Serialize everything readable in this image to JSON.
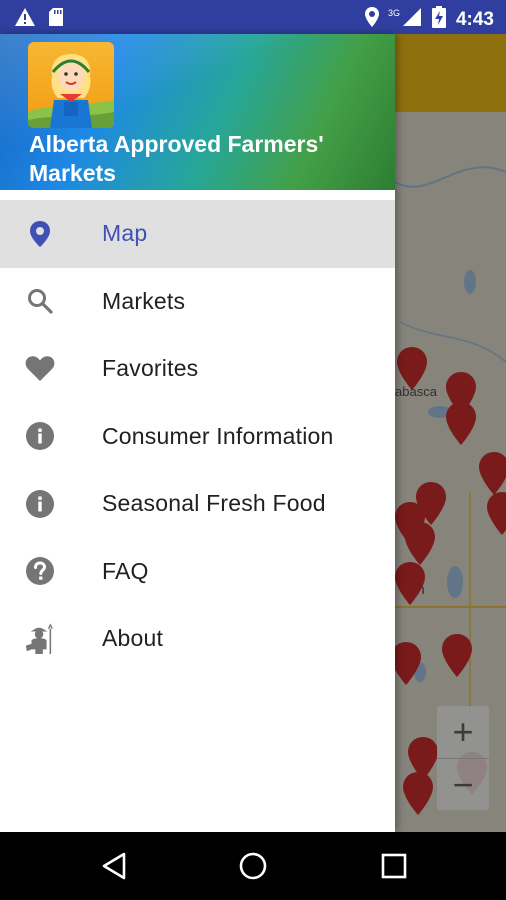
{
  "status_bar": {
    "time": "4:43",
    "network_type": "3G",
    "icons": [
      "warning-icon",
      "sd-card-icon",
      "location-icon",
      "signal-icon",
      "battery-charging-icon"
    ]
  },
  "app": {
    "title": "Alberta Approved Farmers' Markets",
    "accent_color": "#3F51B5",
    "toolbar_color": "#F4C21A"
  },
  "drawer": {
    "active_item": "Map",
    "items": [
      {
        "label": "Map",
        "icon": "location-pin-icon"
      },
      {
        "label": "Markets",
        "icon": "search-icon"
      },
      {
        "label": "Favorites",
        "icon": "heart-icon"
      },
      {
        "label": "Consumer Information",
        "icon": "info-icon"
      },
      {
        "label": "Seasonal Fresh Food",
        "icon": "info-icon"
      },
      {
        "label": "FAQ",
        "icon": "help-icon"
      },
      {
        "label": "About",
        "icon": "farmer-icon"
      }
    ]
  },
  "map": {
    "partial_labels": [
      "abasca",
      "on"
    ],
    "zoom_in_label": "+",
    "zoom_out_label": "−"
  },
  "nav_bar": {
    "buttons": [
      "back-icon",
      "home-icon",
      "recents-icon"
    ]
  }
}
